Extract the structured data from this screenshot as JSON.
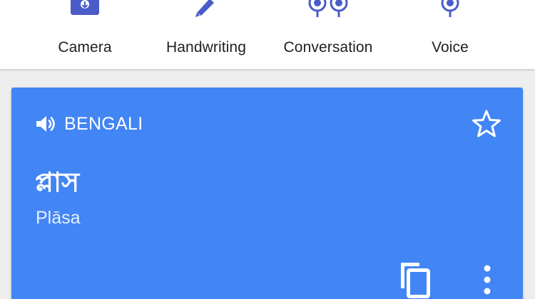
{
  "toolbar": {
    "items": [
      {
        "label": "Camera",
        "icon": "camera-icon"
      },
      {
        "label": "Handwriting",
        "icon": "pen-icon"
      },
      {
        "label": "Conversation",
        "icon": "conversation-mic-icon"
      },
      {
        "label": "Voice",
        "icon": "mic-icon"
      }
    ],
    "icon_color": "#4a5cc9"
  },
  "result_card": {
    "language": "BENGALI",
    "translated_text": "প্লাস",
    "transliteration": "Plāsa",
    "background_color": "#4285f4",
    "actions": {
      "speak_icon": "speaker-icon",
      "favorite_icon": "star-outline-icon",
      "copy_icon": "copy-icon",
      "more_icon": "more-vert-icon"
    }
  }
}
